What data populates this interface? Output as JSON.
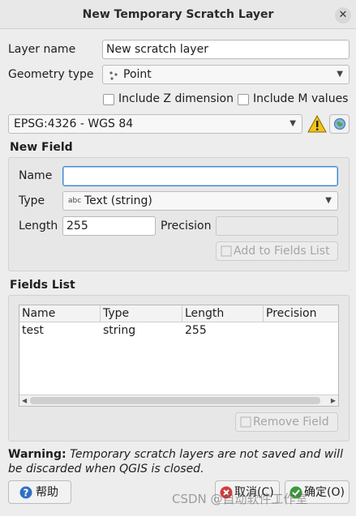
{
  "window": {
    "title": "New Temporary Scratch Layer",
    "close_glyph": "✕"
  },
  "layer": {
    "name_label": "Layer name",
    "name_value": "New scratch layer",
    "geometry_label": "Geometry type",
    "geometry_icon": "point-geometry-icon",
    "geometry_value": "Point",
    "include_z_label": "Include Z dimension",
    "include_z_checked": false,
    "include_m_label": "Include M values",
    "include_m_checked": false,
    "crs_value": "EPSG:4326 - WGS 84"
  },
  "new_field": {
    "title": "New Field",
    "name_label": "Name",
    "name_value": "",
    "type_label": "Type",
    "type_icon_text": "abc",
    "type_value": "Text (string)",
    "length_label": "Length",
    "length_value": "255",
    "precision_label": "Precision",
    "precision_value": "",
    "add_button_label": "Add to Fields List"
  },
  "fields_list": {
    "title": "Fields List",
    "columns": [
      "Name",
      "Type",
      "Length",
      "Precision"
    ],
    "rows": [
      [
        "test",
        "string",
        "255",
        ""
      ]
    ],
    "remove_button_label": "Remove Field"
  },
  "warning": {
    "bold": "Warning:",
    "text": " Temporary scratch layers are not saved and will be discarded when QGIS is closed."
  },
  "footer": {
    "help_label": "帮助",
    "cancel_label": "取消(C)",
    "ok_label": "确定(O)",
    "watermark": "CSDN @自动软件工作室"
  },
  "colors": {
    "accent_focus": "#3a86d4",
    "help_icon": "#2f6fc4",
    "cancel_icon": "#d33c3c",
    "ok_icon": "#3b9a3b",
    "warning_icon": "#f2c31b"
  }
}
